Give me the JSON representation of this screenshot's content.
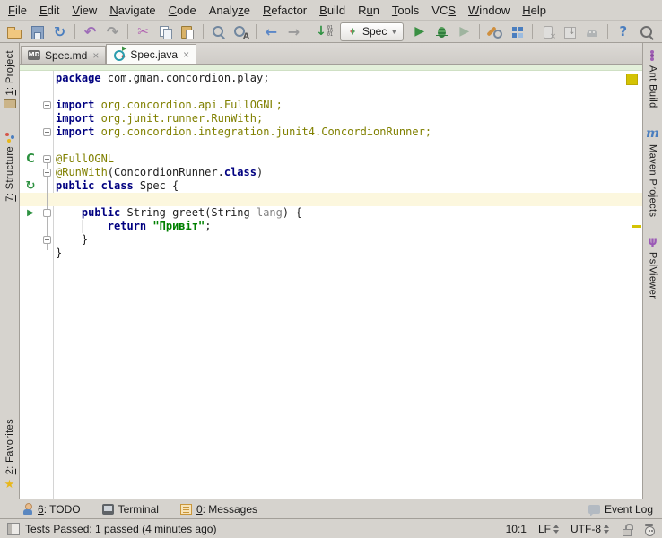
{
  "menu": {
    "items": [
      {
        "label": "File",
        "u": 0
      },
      {
        "label": "Edit",
        "u": 0
      },
      {
        "label": "View",
        "u": 0
      },
      {
        "label": "Navigate",
        "u": 0
      },
      {
        "label": "Code",
        "u": 0
      },
      {
        "label": "Analyze",
        "u": 5
      },
      {
        "label": "Refactor",
        "u": 0
      },
      {
        "label": "Build",
        "u": 0
      },
      {
        "label": "Run",
        "u": 1
      },
      {
        "label": "Tools",
        "u": 0
      },
      {
        "label": "VCS",
        "u": 2
      },
      {
        "label": "Window",
        "u": 0
      },
      {
        "label": "Help",
        "u": 0
      }
    ]
  },
  "toolbar": {
    "run_config": "Spec",
    "items": [
      {
        "icon": "open-folder-icon"
      },
      {
        "icon": "save-icon"
      },
      {
        "icon": "synchronize-icon"
      },
      {
        "sep": true
      },
      {
        "icon": "undo-icon"
      },
      {
        "icon": "redo-icon"
      },
      {
        "sep": true
      },
      {
        "icon": "cut-icon"
      },
      {
        "icon": "copy-icon"
      },
      {
        "icon": "paste-icon"
      },
      {
        "sep": true
      },
      {
        "icon": "find-icon"
      },
      {
        "icon": "replace-icon"
      },
      {
        "sep": true
      },
      {
        "icon": "back-icon"
      },
      {
        "icon": "forward-icon"
      },
      {
        "sep": true
      },
      {
        "icon": "update-project-icon"
      },
      {
        "run_config": true
      },
      {
        "icon": "run-icon"
      },
      {
        "icon": "debug-icon"
      },
      {
        "icon": "coverage-icon"
      },
      {
        "sep": true
      },
      {
        "icon": "settings-icon"
      },
      {
        "icon": "project-structure-icon"
      },
      {
        "sep": true
      },
      {
        "icon": "device-icon",
        "grayed": true
      },
      {
        "icon": "sdk-download-icon",
        "grayed": true
      },
      {
        "icon": "android-icon",
        "grayed": true
      },
      {
        "sep": true
      },
      {
        "icon": "help-icon"
      },
      {
        "spacer": true
      },
      {
        "icon": "search-everywhere-icon"
      }
    ]
  },
  "tabs": [
    {
      "label": "Spec.md",
      "icon": "markdown-file-icon",
      "active": false,
      "close": "×"
    },
    {
      "label": "Spec.java",
      "icon": "concordion-class-icon",
      "active": true,
      "close": "×"
    }
  ],
  "left_stripe": [
    {
      "label": "1: Project",
      "u": 0,
      "icon": "project-icon",
      "icon_pos": "after",
      "section": "top"
    },
    {
      "label": "7: Structure",
      "u": 0,
      "icon": "structure-icon",
      "icon_pos": "before",
      "section": "top"
    },
    {
      "label": "2: Favorites",
      "u": 0,
      "icon": "favorites-icon",
      "icon_pos": "after",
      "section": "bottom"
    }
  ],
  "right_stripe": [
    {
      "label": "Ant Build",
      "icon": "ant-icon",
      "icon_pos": "before",
      "section": "top"
    },
    {
      "label": "Maven Projects",
      "icon": "maven-icon",
      "icon_pos": "before",
      "section": "top"
    },
    {
      "label": "PsiViewer",
      "icon": "psiviewer-icon",
      "icon_pos": "before",
      "section": "top"
    }
  ],
  "editor": {
    "caret_line": 10,
    "lines": [
      {
        "segments": [
          {
            "t": "package",
            "s": "k"
          },
          {
            "t": " com.gman.concordion.play;",
            "s": "p"
          }
        ]
      },
      {
        "segments": []
      },
      {
        "segments": [
          {
            "t": "import",
            "s": "k"
          },
          {
            "t": " ",
            "s": "p"
          },
          {
            "t": "org.concordion.api.FullOGNL;",
            "s": "a"
          }
        ]
      },
      {
        "segments": [
          {
            "t": "import",
            "s": "k"
          },
          {
            "t": " ",
            "s": "p"
          },
          {
            "t": "org.junit.runner.RunWith;",
            "s": "a"
          }
        ]
      },
      {
        "segments": [
          {
            "t": "import",
            "s": "k"
          },
          {
            "t": " ",
            "s": "p"
          },
          {
            "t": "org.concordion.integration.junit4.ConcordionRunner;",
            "s": "a"
          }
        ]
      },
      {
        "segments": []
      },
      {
        "segments": [
          {
            "t": "@FullOGNL",
            "s": "a"
          }
        ]
      },
      {
        "segments": [
          {
            "t": "@RunWith",
            "s": "a"
          },
          {
            "t": "(ConcordionRunner.",
            "s": "p"
          },
          {
            "t": "class",
            "s": "k"
          },
          {
            "t": ")",
            "s": "p"
          }
        ]
      },
      {
        "segments": [
          {
            "t": "public class",
            "s": "k"
          },
          {
            "t": " Spec {",
            "s": "p"
          }
        ]
      },
      {
        "segments": []
      },
      {
        "segments": [
          {
            "t": "    ",
            "s": "p"
          },
          {
            "t": "public",
            "s": "k"
          },
          {
            "t": " String greet(String ",
            "s": "p"
          },
          {
            "t": "lang",
            "s": "g"
          },
          {
            "t": ") {",
            "s": "p"
          }
        ]
      },
      {
        "segments": [
          {
            "t": "        ",
            "s": "p"
          },
          {
            "t": "return",
            "s": "k"
          },
          {
            "t": " ",
            "s": "p"
          },
          {
            "t": "\"Привіт\"",
            "s": "s"
          },
          {
            "t": ";",
            "s": "p"
          }
        ]
      },
      {
        "segments": [
          {
            "t": "    }",
            "s": "p"
          }
        ]
      },
      {
        "segments": [
          {
            "t": "}",
            "s": "p"
          }
        ]
      }
    ],
    "gutter_icons": [
      {
        "line": 7,
        "icon": "concordion-run-icon"
      },
      {
        "line": 9,
        "icon": "run-class-icon"
      },
      {
        "line": 11,
        "icon": "run-method-icon"
      }
    ],
    "fold_lines": [
      3,
      5,
      7,
      8,
      11,
      13
    ],
    "fold_guide": {
      "from_line": 7,
      "to_line": 14
    },
    "indent_guides": [
      {
        "line": 12,
        "column": 4
      }
    ],
    "warning_mark_lines": [
      12
    ]
  },
  "bottom_bar": {
    "items": [
      {
        "label": "6: TODO",
        "u": 0,
        "icon": "todo-icon"
      },
      {
        "label": "Terminal",
        "icon": "terminal-icon"
      },
      {
        "label": "0: Messages",
        "u": 0,
        "icon": "messages-icon"
      }
    ],
    "event_log": {
      "label": "Event Log",
      "icon": "event-log-icon"
    }
  },
  "status_bar": {
    "message": "Tests Passed: 1 passed (4 minutes ago)",
    "caret_position": "10:1",
    "line_separator": "LF",
    "encoding": "UTF-8"
  },
  "colors": {
    "keyword": "#000080",
    "annotation": "#808000",
    "string": "#008000",
    "unused_param": "#808080",
    "caret_line_bg": "#fcf7de",
    "editor_bg": "#ffffff",
    "chrome_bg": "#d6d3ce",
    "tab_strip_green": "#e3f0da",
    "warning_stripe": "#d4c303",
    "run_green": "#3a9043"
  }
}
